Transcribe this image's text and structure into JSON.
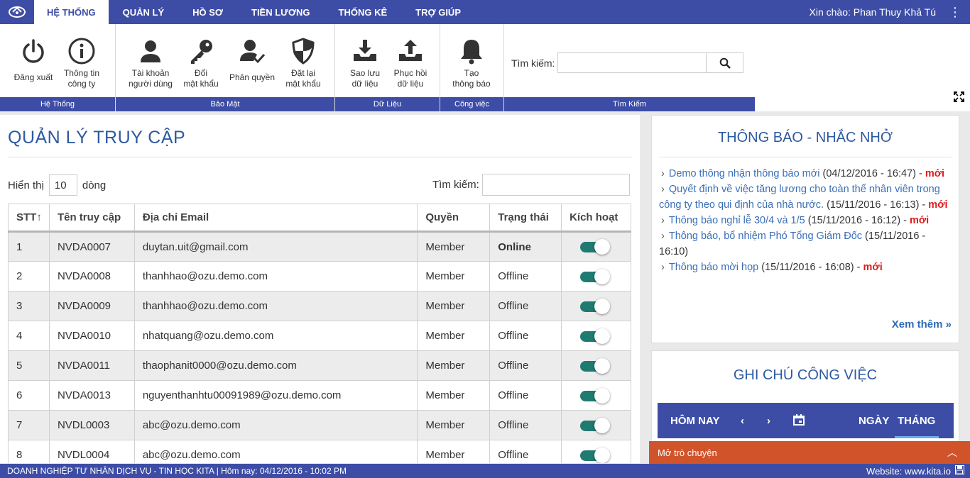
{
  "nav": {
    "tabs": [
      "HỆ THỐNG",
      "QUẢN LÝ",
      "HỒ SƠ",
      "TIỀN LƯƠNG",
      "THỐNG KÊ",
      "TRỢ GIÚP"
    ],
    "greeting": "Xin chào: Phan Thuy Khả Tú"
  },
  "ribbon": {
    "groups": {
      "system": "Hệ Thống",
      "security": "Bảo Mật",
      "data": "Dữ Liệu",
      "work": "Công việc",
      "search": "Tìm Kiếm"
    },
    "buttons": {
      "logout": [
        "Đăng xuất"
      ],
      "company_info": [
        "Thông tin",
        "công ty"
      ],
      "user_account": [
        "Tài khoản",
        "người dùng"
      ],
      "change_password": [
        "Đổi",
        "mật khẩu"
      ],
      "permissions": [
        "Phân quyền"
      ],
      "reset_password": [
        "Đặt lại",
        "mật khẩu"
      ],
      "backup": [
        "Sao lưu",
        "dữ liệu"
      ],
      "restore": [
        "Phục hồi",
        "dữ liệu"
      ],
      "create_notice": [
        "Tạo",
        "thông báo"
      ]
    },
    "search_label": "Tìm kiếm:",
    "search_value": ""
  },
  "main": {
    "title": "QUẢN LÝ TRUY CẬP",
    "show_label": "Hiển thị",
    "page_size": "10",
    "rows_label": "dòng",
    "search_label": "Tìm kiếm:",
    "search_value": "",
    "columns": [
      "STT",
      "Tên truy cập",
      "Địa chỉ Email",
      "Quyền",
      "Trạng thái",
      "Kích hoạt"
    ],
    "sort_marker": "↑",
    "rows": [
      {
        "stt": "1",
        "user": "NVDA0007",
        "email": "duytan.uit@gmail.com",
        "role": "Member",
        "status": "Online",
        "active": true
      },
      {
        "stt": "2",
        "user": "NVDA0008",
        "email": "thanhhao@ozu.demo.com",
        "role": "Member",
        "status": "Offline",
        "active": true
      },
      {
        "stt": "3",
        "user": "NVDA0009",
        "email": "thanhhao@ozu.demo.com",
        "role": "Member",
        "status": "Offline",
        "active": true
      },
      {
        "stt": "4",
        "user": "NVDA0010",
        "email": "nhatquang@ozu.demo.com",
        "role": "Member",
        "status": "Offline",
        "active": true
      },
      {
        "stt": "5",
        "user": "NVDA0011",
        "email": "thaophanit0000@ozu.demo.com",
        "role": "Member",
        "status": "Offline",
        "active": true
      },
      {
        "stt": "6",
        "user": "NVDA0013",
        "email": "nguyenthanhtu00091989@ozu.demo.com",
        "role": "Member",
        "status": "Offline",
        "active": true
      },
      {
        "stt": "7",
        "user": "NVDL0003",
        "email": "abc@ozu.demo.com",
        "role": "Member",
        "status": "Offline",
        "active": true
      },
      {
        "stt": "8",
        "user": "NVDL0004",
        "email": "abc@ozu.demo.com",
        "role": "Member",
        "status": "Offline",
        "active": true
      }
    ]
  },
  "notice": {
    "title": "THÔNG BÁO - NHẮC NHỞ",
    "items": [
      {
        "link": "Demo thông nhận thông báo mới",
        "date": " (04/12/2016 - 16:47) -",
        "new": "mới"
      },
      {
        "link": "Quyết định về việc tăng lương cho toàn thể nhân viên trong công ty theo qui định của nhà nước.",
        "date": " (15/11/2016 - 16:13) -",
        "new": "mới"
      },
      {
        "link": "Thông báo nghỉ lễ 30/4 và 1/5",
        "date": " (15/11/2016 - 16:12) -",
        "new": "mới"
      },
      {
        "link": "Thông báo, bổ nhiệm Phó Tổng Giám Đốc",
        "date": " (15/11/2016 - 16:10)",
        "new": ""
      },
      {
        "link": "Thông báo mời họp",
        "date": " (15/11/2016 - 16:08) -",
        "new": "mới"
      }
    ],
    "more": "Xem thêm"
  },
  "tasks": {
    "title": "GHI CHÚ CÔNG VIỆC",
    "today": "HÔM NAY",
    "day": "NGÀY",
    "month": "THÁNG"
  },
  "chat": {
    "label": "Mở trò chuyện"
  },
  "footer": {
    "left": "DOANH NGHIỆP TƯ NHÂN DỊCH VỤ - TIN HỌC KITA | Hôm nay: 04/12/2016 - 10:02 PM",
    "right": "Website: www.kita.io"
  },
  "colors": {
    "brand": "#3d4da6",
    "title": "#2d5aa0",
    "online": "#1e8c1e",
    "toggle": "#1f7a72",
    "new": "#e01a1a",
    "chat": "#d1532a"
  }
}
